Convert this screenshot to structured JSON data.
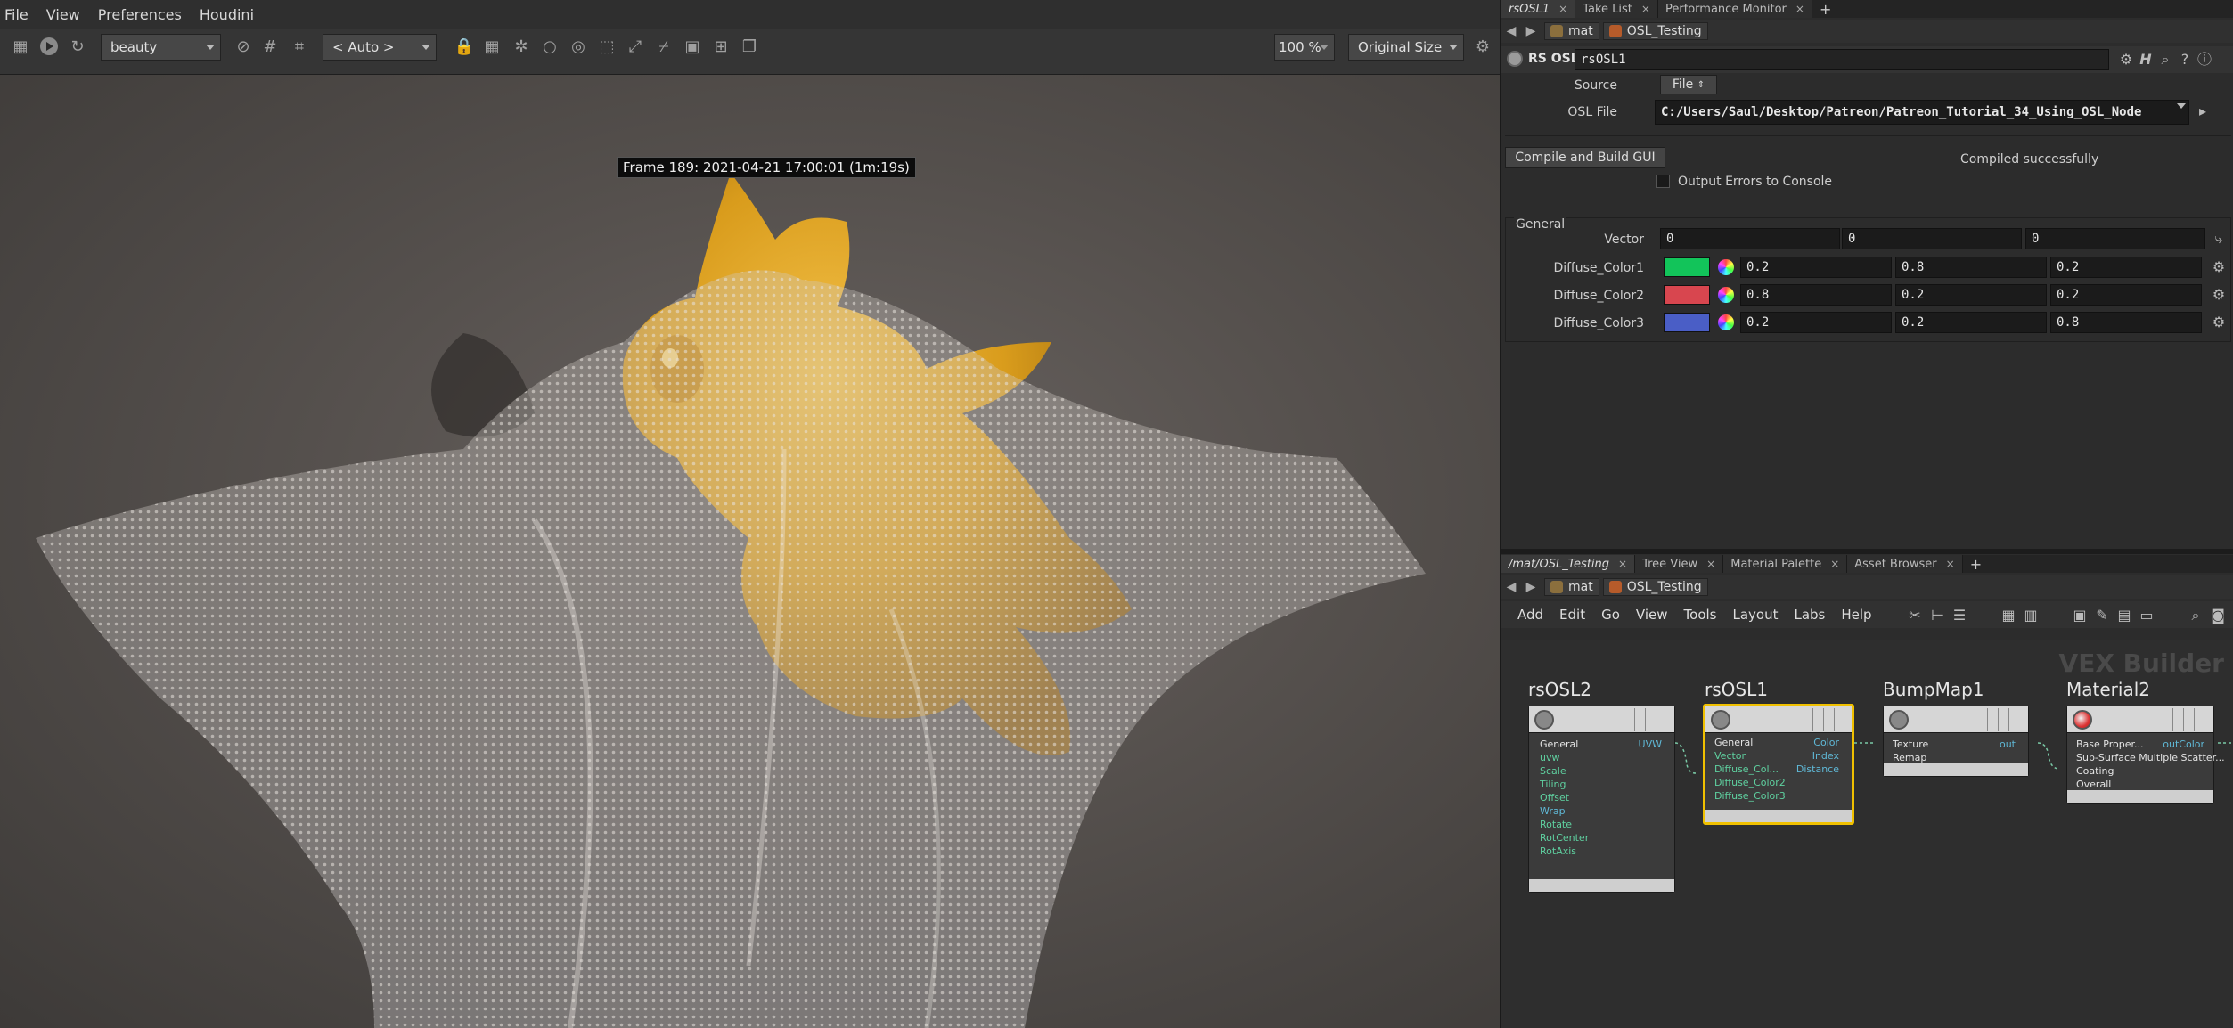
{
  "menu": {
    "items": [
      "File",
      "View",
      "Preferences",
      "Houdini"
    ]
  },
  "render_view": {
    "aov_selector": "beauty",
    "camera_selector": "< Auto >",
    "zoom": "100 %",
    "size_mode": "Original Size",
    "frame_label": "Frame 189: 2021-04-21 17:00:01 (1m:19s)"
  },
  "param_pane": {
    "tabs": [
      {
        "label": "rsOSL1",
        "active": true
      },
      {
        "label": "Take List"
      },
      {
        "label": "Performance Monitor"
      }
    ],
    "path": {
      "context": "mat",
      "network": "OSL_Testing"
    },
    "node_type": "RS OSL",
    "node_name": "rsOSL1",
    "source_label": "Source",
    "source_value": "File",
    "osl_file_label": "OSL File",
    "osl_file_value": "C:/Users/Saul/Desktop/Patreon/Patreon_Tutorial_34_Using_OSL_Node",
    "compile_button": "Compile and Build GUI",
    "compile_status": "Compiled successfully",
    "output_errors_label": "Output Errors to Console",
    "section_general": "General",
    "vector": {
      "label": "Vector",
      "values": [
        "0",
        "0",
        "0"
      ]
    },
    "colors": [
      {
        "label": "Diffuse_Color1",
        "swatch": "#12c45a",
        "values": [
          "0.2",
          "0.8",
          "0.2"
        ]
      },
      {
        "label": "Diffuse_Color2",
        "swatch": "#d8464f",
        "values": [
          "0.8",
          "0.2",
          "0.2"
        ]
      },
      {
        "label": "Diffuse_Color3",
        "swatch": "#4a5ec6",
        "values": [
          "0.2",
          "0.2",
          "0.8"
        ]
      }
    ]
  },
  "network_pane": {
    "tabs": [
      {
        "label": "/mat/OSL_Testing",
        "active": true
      },
      {
        "label": "Tree View"
      },
      {
        "label": "Material Palette"
      },
      {
        "label": "Asset Browser"
      }
    ],
    "path": {
      "context": "mat",
      "network": "OSL_Testing"
    },
    "menu": [
      "Add",
      "Edit",
      "Go",
      "View",
      "Tools",
      "Layout",
      "Labs",
      "Help"
    ],
    "title": "VEX Builder",
    "nodes": {
      "rsosl2": {
        "name": "rsOSL2",
        "group": "General",
        "inputs": [
          "uvw",
          "Scale",
          "Tiling",
          "Offset",
          "Wrap",
          "Rotate",
          "RotCenter",
          "RotAxis"
        ],
        "outputs": [
          "UVW"
        ]
      },
      "rsosl1": {
        "name": "rsOSL1",
        "group": "General",
        "inputs": [
          "Vector",
          "Diffuse_Col...",
          "Diffuse_Color2",
          "Diffuse_Color3"
        ],
        "outputs": [
          "Color",
          "Index",
          "Distance"
        ]
      },
      "bumpmap1": {
        "name": "BumpMap1",
        "inputs": [
          "Texture",
          "Remap"
        ],
        "outputs": [
          "out"
        ]
      },
      "material2": {
        "name": "Material2",
        "inputs": [
          "Base Proper...",
          "Sub-Surface Multiple Scatter...",
          "Coating",
          "Overall"
        ],
        "outputs": [
          "outColor"
        ]
      }
    }
  }
}
